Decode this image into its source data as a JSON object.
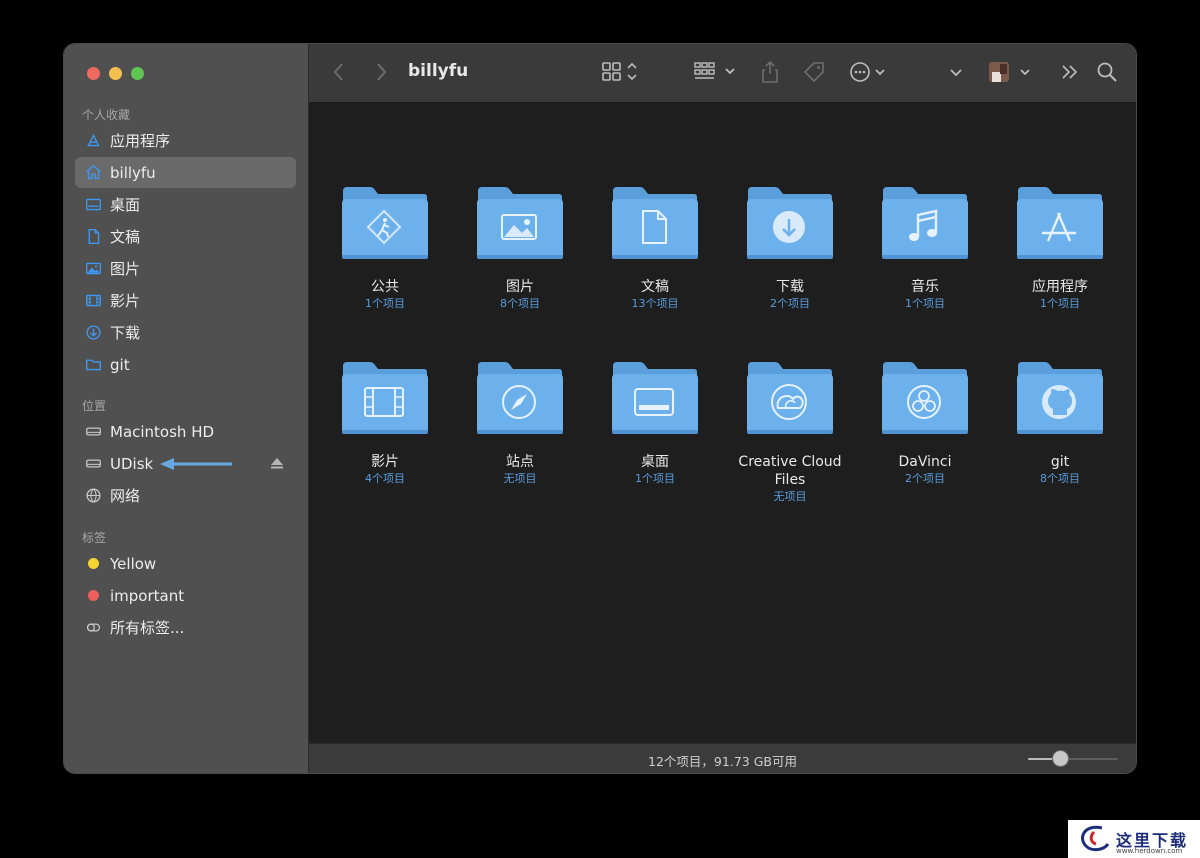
{
  "sidebar": {
    "favorites_title": "个人收藏",
    "favorites": [
      {
        "label": "应用程序",
        "icon": "apps-icon"
      },
      {
        "label": "billyfu",
        "icon": "home-icon",
        "selected": true
      },
      {
        "label": "桌面",
        "icon": "desktop-icon"
      },
      {
        "label": "文稿",
        "icon": "document-icon"
      },
      {
        "label": "图片",
        "icon": "photo-icon"
      },
      {
        "label": "影片",
        "icon": "film-icon"
      },
      {
        "label": "下载",
        "icon": "download-icon"
      },
      {
        "label": "git",
        "icon": "folder-icon"
      }
    ],
    "locations_title": "位置",
    "locations": [
      {
        "label": "Macintosh HD",
        "icon": "drive-icon"
      },
      {
        "label": "UDisk",
        "icon": "drive-icon"
      },
      {
        "label": "网络",
        "icon": "globe-icon"
      }
    ],
    "tags_title": "标签",
    "tags": [
      {
        "label": "Yellow",
        "color": "#f4d534"
      },
      {
        "label": "important",
        "color": "#ee5f5b"
      },
      {
        "label": "所有标签...",
        "icon": "all-tags-icon"
      }
    ]
  },
  "toolbar": {
    "title": "billyfu"
  },
  "folders": [
    {
      "name": "公共",
      "count": "1个项目",
      "glyph": "public"
    },
    {
      "name": "图片",
      "count": "8个项目",
      "glyph": "photo"
    },
    {
      "name": "文稿",
      "count": "13个项目",
      "glyph": "doc"
    },
    {
      "name": "下载",
      "count": "2个项目",
      "glyph": "download"
    },
    {
      "name": "音乐",
      "count": "1个项目",
      "glyph": "music"
    },
    {
      "name": "应用程序",
      "count": "1个项目",
      "glyph": "apps"
    },
    {
      "name": "影片",
      "count": "4个项目",
      "glyph": "film"
    },
    {
      "name": "站点",
      "count": "无项目",
      "glyph": "compass"
    },
    {
      "name": "桌面",
      "count": "1个项目",
      "glyph": "desktop"
    },
    {
      "name": "Creative Cloud Files",
      "count": "无项目",
      "glyph": "cc"
    },
    {
      "name": "DaVinci",
      "count": "2个项目",
      "glyph": "davinci"
    },
    {
      "name": "git",
      "count": "8个项目",
      "glyph": "github"
    }
  ],
  "status": {
    "text": "12个项目，91.73 GB可用",
    "zoom_level": 0.35
  },
  "colors": {
    "folder_body": "#6cb1ec",
    "folder_tab": "#5a9fdc",
    "accent": "#5a9bdc"
  },
  "watermark": {
    "text": "这里下载",
    "url": "www.herdown.com"
  }
}
